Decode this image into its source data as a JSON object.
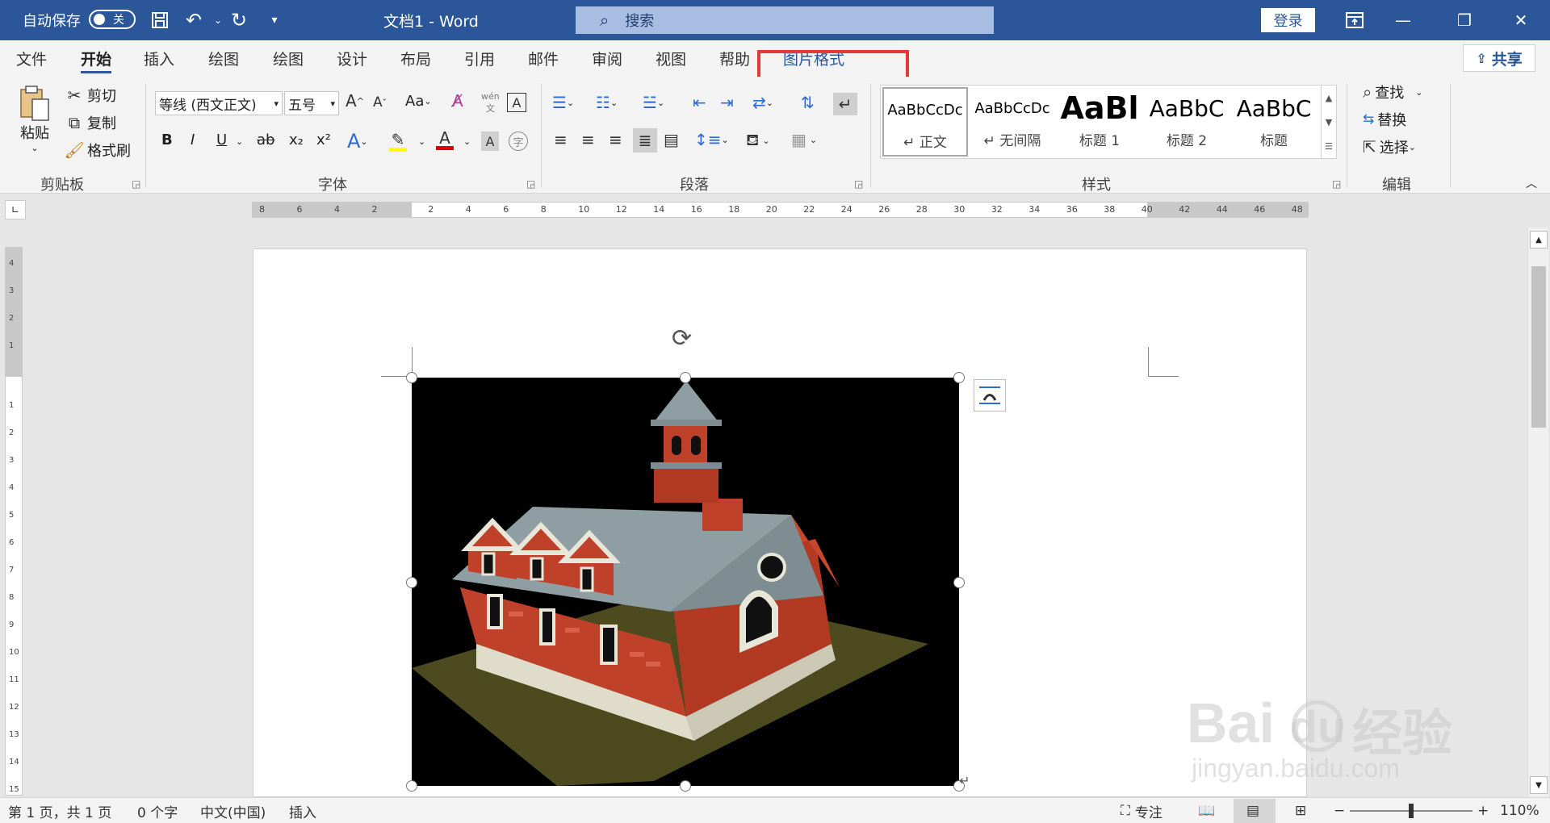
{
  "titlebar": {
    "autosave_label": "自动保存",
    "autosave_state": "关",
    "doc_title": "文档1  -  Word",
    "search_placeholder": "搜索",
    "login": "登录"
  },
  "tabs": [
    "文件",
    "开始",
    "插入",
    "绘图",
    "绘图",
    "设计",
    "布局",
    "引用",
    "邮件",
    "审阅",
    "视图",
    "帮助",
    "图片格式"
  ],
  "share": "共享",
  "clipboard": {
    "paste": "粘贴",
    "cut": "剪切",
    "copy": "复制",
    "format_painter": "格式刷",
    "group_label": "剪贴板"
  },
  "font": {
    "font_name": "等线 (西文正文)",
    "font_size": "五号",
    "grow": "A",
    "shrink": "A",
    "change_case": "Aa",
    "phonetic": "wén",
    "bold": "B",
    "italic": "I",
    "underline": "U",
    "strike": "ab",
    "subscript": "x₂",
    "superscript": "x²",
    "text_effect": "A",
    "font_color": "A",
    "char_shading": "A",
    "enclose": "字",
    "group_label": "字体"
  },
  "paragraph": {
    "group_label": "段落"
  },
  "styles": {
    "items": [
      {
        "sample": "AaBbCcDc",
        "name": "↵ 正文"
      },
      {
        "sample": "AaBbCcDc",
        "name": "↵ 无间隔"
      },
      {
        "sample": "AaBl",
        "name": "标题 1"
      },
      {
        "sample": "AaBbC",
        "name": "标题 2"
      },
      {
        "sample": "AaBbC",
        "name": "标题"
      }
    ],
    "group_label": "样式"
  },
  "editing": {
    "find": "查找",
    "replace": "替换",
    "select": "选择",
    "group_label": "编辑"
  },
  "ruler": {
    "h_numbers": [
      "8",
      "6",
      "4",
      "2",
      "2",
      "4",
      "6",
      "8",
      "10",
      "12",
      "14",
      "16",
      "18",
      "20",
      "22",
      "24",
      "26",
      "28",
      "30",
      "32",
      "34",
      "36",
      "38",
      "40",
      "42",
      "44",
      "46",
      "48"
    ],
    "v_numbers": [
      "4",
      "3",
      "2",
      "1",
      "1",
      "2",
      "3",
      "4",
      "5",
      "6",
      "7",
      "8",
      "9",
      "10",
      "11",
      "12",
      "13",
      "14",
      "15"
    ]
  },
  "statusbar": {
    "page": "第 1 页，共 1 页",
    "words": "0 个字",
    "language": "中文(中国)",
    "mode": "插入",
    "focus": "专注",
    "zoom": "110%"
  },
  "watermark": {
    "brand": "Bai",
    "brand2": "du",
    "cn": "经验",
    "url": "jingyan.baidu.com"
  },
  "colors": {
    "titlebar": "#2b579a",
    "highlight": "#e53935",
    "font_color_bar": "#e00000",
    "highlight_bar": "#ffff00"
  }
}
